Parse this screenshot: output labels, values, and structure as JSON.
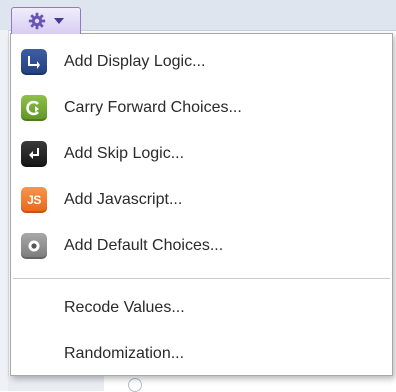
{
  "toolbar": {
    "gear_button": {
      "icon": "gear-icon",
      "caret_icon": "caret-down-icon",
      "color": "#6a54b4"
    }
  },
  "menu": {
    "items": [
      {
        "label": "Add Display Logic...",
        "icon": "display-logic-icon",
        "color": "#2f4f95"
      },
      {
        "label": "Carry Forward Choices...",
        "icon": "carry-forward-icon",
        "color": "#77ab35"
      },
      {
        "label": "Add Skip Logic...",
        "icon": "skip-logic-icon",
        "color": "#262626"
      },
      {
        "label": "Add Javascript...",
        "icon": "javascript-icon",
        "icon_text": "JS",
        "color": "#f07a30"
      },
      {
        "label": "Add Default Choices...",
        "icon": "default-choices-icon",
        "color": "#8e8e8e"
      }
    ],
    "secondary_items": [
      {
        "label": "Recode Values..."
      },
      {
        "label": "Randomization..."
      }
    ]
  }
}
